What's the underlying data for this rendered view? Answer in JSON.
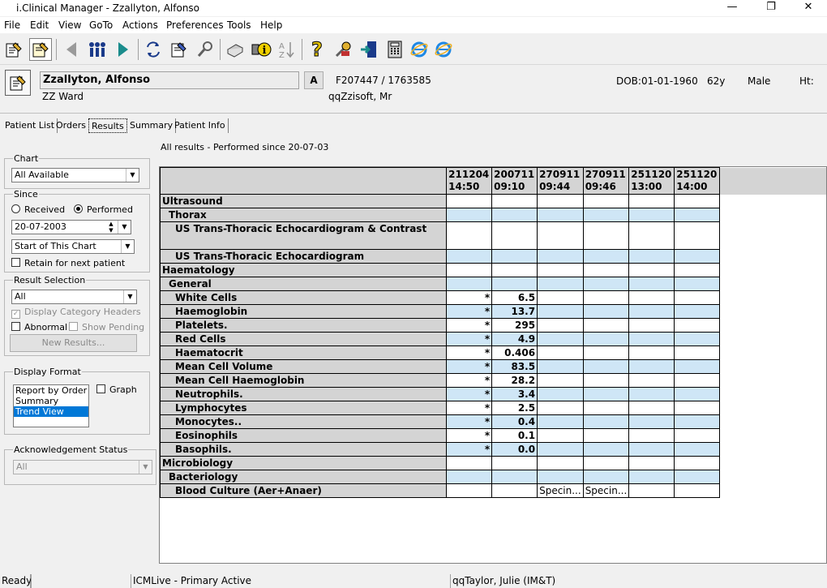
{
  "window": {
    "title": "i.Clinical Manager - Zzallyton, Alfonso",
    "minimize": "—",
    "restore": "❐",
    "close": "✕"
  },
  "menu": [
    "File",
    "Edit",
    "View",
    "GoTo",
    "Actions",
    "Preferences",
    "Tools",
    "Help"
  ],
  "patient": {
    "name": "Zzallyton, Alfonso",
    "ward": "ZZ Ward",
    "alert_button": "A",
    "ids": "F207447 / 1763585",
    "consultant": "qqZzisoft, Mr",
    "dob": "DOB:01-01-1960",
    "age": "62y",
    "sex": "Male",
    "height": "Ht:"
  },
  "tabs": [
    "Patient List",
    "Orders",
    "Results",
    "Summary",
    "Patient Info"
  ],
  "sidebar": {
    "chart": {
      "legend": "Chart",
      "value": "All Available"
    },
    "since": {
      "legend": "Since",
      "received": "Received",
      "performed": "Performed",
      "date": "20-07-2003",
      "range": "Start of This Chart",
      "retain": "Retain for next patient"
    },
    "result_selection": {
      "legend": "Result Selection",
      "value": "All",
      "display_headers": "Display Category Headers",
      "abnormal": "Abnormal",
      "show_pending": "Show Pending",
      "new_results": "New Results..."
    },
    "display_format": {
      "legend": "Display Format",
      "options": [
        "Report by Order",
        "Summary",
        "Trend View"
      ],
      "graph": "Graph"
    },
    "ack_status": {
      "legend": "Acknowledgement Status",
      "value": "All"
    }
  },
  "results": {
    "caption": "All results - Performed since 20-07-03",
    "columns": [
      {
        "id": "211204",
        "time": "14:50"
      },
      {
        "id": "200711",
        "time": "09:10"
      },
      {
        "id": "270911",
        "time": "09:44"
      },
      {
        "id": "270911",
        "time": "09:46"
      },
      {
        "id": "251120",
        "time": "13:00"
      },
      {
        "id": "251120",
        "time": "14:00"
      }
    ],
    "rows": [
      {
        "label": "Ultrasound",
        "level": 1,
        "blue": false,
        "values": [
          "",
          "",
          "",
          "",
          "",
          ""
        ]
      },
      {
        "label": "Thorax",
        "level": 2,
        "blue": true,
        "values": [
          "",
          "",
          "",
          "",
          "",
          ""
        ]
      },
      {
        "label": "US Trans-Thoracic Echocardiogram & Contrast",
        "level": 3,
        "blue": false,
        "tall": true,
        "values": [
          "",
          "",
          "",
          "",
          "",
          ""
        ]
      },
      {
        "label": "US Trans-Thoracic Echocardiogram",
        "level": 3,
        "blue": true,
        "values": [
          "",
          "",
          "",
          "",
          "",
          ""
        ]
      },
      {
        "label": "Haematology",
        "level": 1,
        "blue": false,
        "values": [
          "",
          "",
          "",
          "",
          "",
          ""
        ]
      },
      {
        "label": "General",
        "level": 2,
        "blue": true,
        "values": [
          "",
          "",
          "",
          "",
          "",
          ""
        ]
      },
      {
        "label": "White Cells",
        "level": 3,
        "blue": false,
        "values": [
          "*",
          "6.5",
          "",
          "",
          "",
          ""
        ]
      },
      {
        "label": "Haemoglobin",
        "level": 3,
        "blue": true,
        "values": [
          "*",
          "13.7",
          "",
          "",
          "",
          ""
        ]
      },
      {
        "label": "Platelets.",
        "level": 3,
        "blue": false,
        "values": [
          "*",
          "295",
          "",
          "",
          "",
          ""
        ]
      },
      {
        "label": "Red Cells",
        "level": 3,
        "blue": true,
        "values": [
          "*",
          "4.9",
          "",
          "",
          "",
          ""
        ]
      },
      {
        "label": "Haematocrit",
        "level": 3,
        "blue": false,
        "values": [
          "*",
          "0.406",
          "",
          "",
          "",
          ""
        ]
      },
      {
        "label": "Mean Cell Volume",
        "level": 3,
        "blue": true,
        "values": [
          "*",
          "83.5",
          "",
          "",
          "",
          ""
        ]
      },
      {
        "label": "Mean Cell Haemoglobin",
        "level": 3,
        "blue": false,
        "values": [
          "*",
          "28.2",
          "",
          "",
          "",
          ""
        ]
      },
      {
        "label": "Neutrophils.",
        "level": 3,
        "blue": true,
        "values": [
          "*",
          "3.4",
          "",
          "",
          "",
          ""
        ]
      },
      {
        "label": "Lymphocytes",
        "level": 3,
        "blue": false,
        "values": [
          "*",
          "2.5",
          "",
          "",
          "",
          ""
        ]
      },
      {
        "label": "Monocytes..",
        "level": 3,
        "blue": true,
        "values": [
          "*",
          "0.4",
          "",
          "",
          "",
          ""
        ]
      },
      {
        "label": "Eosinophils",
        "level": 3,
        "blue": false,
        "values": [
          "*",
          "0.1",
          "",
          "",
          "",
          ""
        ]
      },
      {
        "label": "Basophils.",
        "level": 3,
        "blue": true,
        "values": [
          "*",
          "0.0",
          "",
          "",
          "",
          ""
        ]
      },
      {
        "label": "Microbiology",
        "level": 1,
        "blue": false,
        "values": [
          "",
          "",
          "",
          "",
          "",
          ""
        ]
      },
      {
        "label": "Bacteriology",
        "level": 2,
        "blue": true,
        "values": [
          "",
          "",
          "",
          "",
          "",
          ""
        ]
      },
      {
        "label": "Blood Culture (Aer+Anaer)",
        "level": 3,
        "blue": false,
        "values": [
          "",
          "",
          "Specin...",
          "Specin...",
          "",
          ""
        ]
      }
    ]
  },
  "status": {
    "state": "Ready",
    "blank": "",
    "system": "ICMLive - Primary Active",
    "user": "qqTaylor, Julie (IM&T)"
  },
  "colors": {
    "row_header": "#d4d4d4",
    "alt_row": "#cfe6f6",
    "selection": "#0078d7"
  }
}
